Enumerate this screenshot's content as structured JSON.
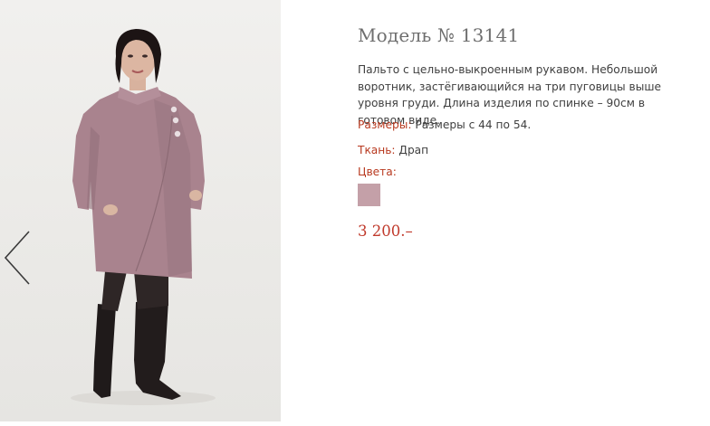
{
  "product": {
    "title": "Модель № 13141",
    "description": "Пальто с цельно-выкроенным рукавом. Небольшой воротник, застёгивающийся на три пуговицы выше уровня груди. Длина изделия по спинке – 90см в готовом виде.",
    "sizes_label": "Размеры:",
    "sizes_value": "Размеры с 44 по 54.",
    "fabric_label": "Ткань:",
    "fabric_value": "Драп",
    "colors_label": "Цвета:",
    "colors": [
      "#c4a0a8"
    ],
    "price": "3 200.–"
  },
  "gallery": {
    "prev_icon": "chevron-left-icon",
    "accent_color": "#b8391f"
  }
}
